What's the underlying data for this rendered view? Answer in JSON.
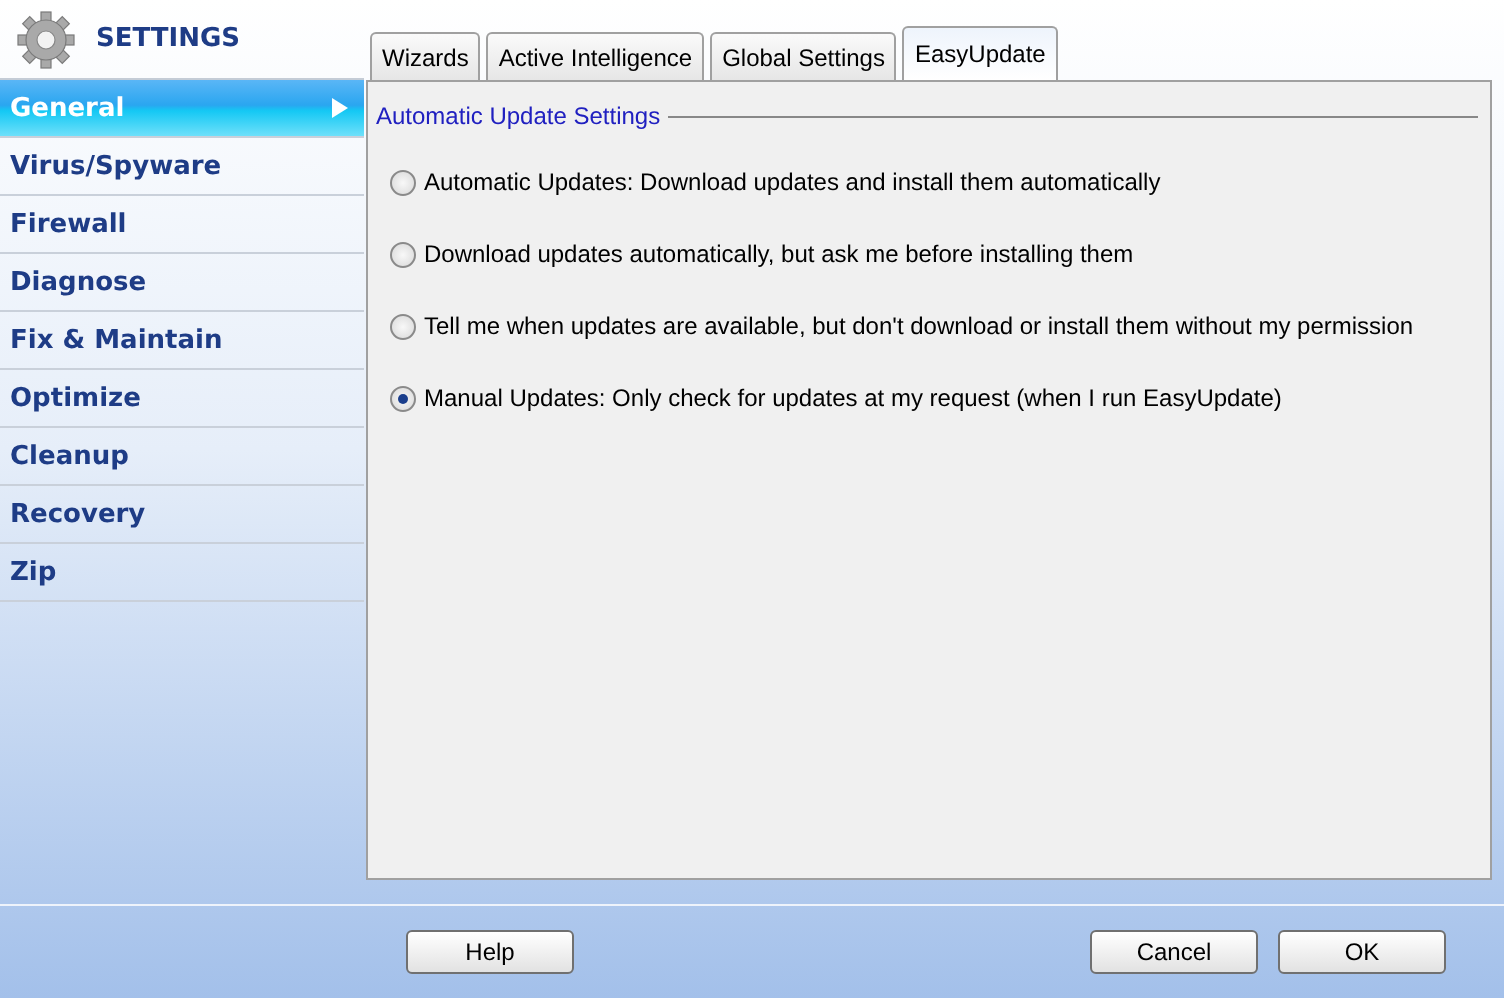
{
  "app": {
    "title": "SETTINGS"
  },
  "sidebar": {
    "items": [
      {
        "label": "General",
        "selected": true
      },
      {
        "label": "Virus/Spyware",
        "selected": false
      },
      {
        "label": "Firewall",
        "selected": false
      },
      {
        "label": "Diagnose",
        "selected": false
      },
      {
        "label": "Fix & Maintain",
        "selected": false
      },
      {
        "label": "Optimize",
        "selected": false
      },
      {
        "label": "Cleanup",
        "selected": false
      },
      {
        "label": "Recovery",
        "selected": false
      },
      {
        "label": "Zip",
        "selected": false
      }
    ]
  },
  "tabs": [
    {
      "label": "Wizards",
      "selected": false
    },
    {
      "label": "Active Intelligence",
      "selected": false
    },
    {
      "label": "Global Settings",
      "selected": false
    },
    {
      "label": "EasyUpdate",
      "selected": true
    }
  ],
  "group": {
    "title": "Automatic Update Settings",
    "options": [
      {
        "label": "Automatic Updates: Download updates and install them automatically",
        "selected": false
      },
      {
        "label": "Download updates automatically, but ask me before installing them",
        "selected": false
      },
      {
        "label": "Tell me when updates are available, but don't download or install them without my permission",
        "selected": false
      },
      {
        "label": "Manual Updates: Only check for updates at my request (when I run EasyUpdate)",
        "selected": true
      }
    ]
  },
  "buttons": {
    "left": [
      "Help"
    ],
    "right": [
      "Cancel",
      "OK"
    ]
  }
}
